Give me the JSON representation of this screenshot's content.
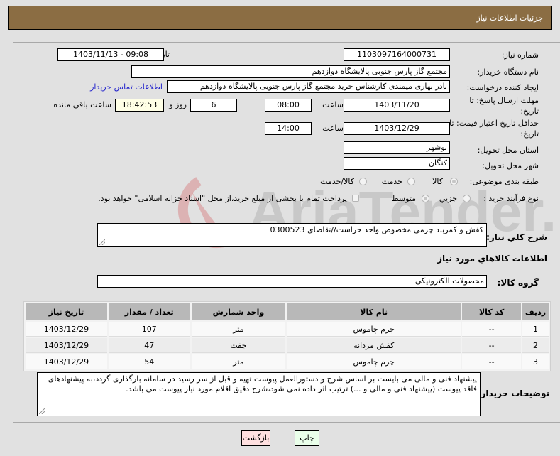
{
  "header": {
    "title": "جزئیات اطلاعات نیاز"
  },
  "watermark": {
    "text": "AriaTender.net",
    "brand_red": "#c0373a",
    "brand_gray": "#888888"
  },
  "form": {
    "need_number": {
      "label": "شماره نیاز:",
      "value": "1103097164000731"
    },
    "announce_datetime": {
      "label": "تاریخ و ساعت اعلان عمومی:",
      "value": "1403/11/13 - 09:08"
    },
    "buyer_org": {
      "label": "نام دستگاه خریدار:",
      "value": "مجتمع گاز پارس جنوبی  پالایشگاه دوازدهم"
    },
    "requester": {
      "label": "ایجاد کننده درخواست:",
      "value": "نادر بهاری میمندی کارشناس خرید مجتمع گاز پارس جنوبی  پالایشگاه دوازدهم"
    },
    "buyer_contact_link": "اطلاعات تماس خریدار",
    "reply_deadline": {
      "label_line1": "مهلت ارسال پاسخ: تا",
      "label_line2": "تاریخ:",
      "date": "1403/11/20",
      "time_label": "ساعت",
      "time": "08:00",
      "days": "6",
      "days_label": "روز و",
      "remaining": "18:42:53",
      "remaining_label": "ساعت باقي مانده"
    },
    "price_validity": {
      "label_line1": "حداقل تاریخ اعتبار قیمت: تا",
      "label_line2": "تاریخ:",
      "date": "1403/12/29",
      "time_label": "ساعت",
      "time": "14:00"
    },
    "delivery_province": {
      "label": "استان محل تحویل:",
      "value": "بوشهر"
    },
    "delivery_city": {
      "label": "شهر محل تحویل:",
      "value": "کنگان"
    },
    "category": {
      "label": "طبقه بندی موضوعی:",
      "options": [
        "کالا",
        "خدمت",
        "کالا/خدمت"
      ],
      "selected": "کالا"
    },
    "purchase_type": {
      "label": "نوع فرآیند خرید :",
      "options": [
        "جزیي",
        "متوسط"
      ],
      "selected": "متوسط",
      "payment_note": "پرداخت تمام یا بخشی از مبلغ خرید،از محل \"اسناد خزانه اسلامی\" خواهد بود.",
      "payment_checked": false
    }
  },
  "description": {
    "label": "شرح کلي نياز:",
    "value": "کفش و کمربند چرمی مخصوص واحد حراست//تقاضای 0300523"
  },
  "goods_section_title": "اطلاعات کالاهاي مورد نياز",
  "goods_group": {
    "label": "گروه کالا:",
    "value": "محصولات الکترونیکی"
  },
  "table": {
    "headers": [
      "ردیف",
      "کد کالا",
      "نام کالا",
      "واحد شمارش",
      "تعداد / مقدار",
      "تاریخ نیاز"
    ],
    "rows": [
      {
        "row": "1",
        "code": "--",
        "name": "چرم چاموس",
        "unit": "متر",
        "qty": "107",
        "date": "1403/12/29"
      },
      {
        "row": "2",
        "code": "--",
        "name": "کفش مردانه",
        "unit": "جفت",
        "qty": "47",
        "date": "1403/12/29"
      },
      {
        "row": "3",
        "code": "--",
        "name": "چرم چاموس",
        "unit": "متر",
        "qty": "54",
        "date": "1403/12/29"
      }
    ]
  },
  "buyer_notes": {
    "label": "توضیحات خریدار:",
    "value": "پیشنهاد فنی و مالی می بایست بر اساس شرح و دستورالعمل پیوست تهیه و قبل از سر رسید در سامانه بارگذاری گردد،به پیشنهادهای فاقد پیوست (پیشنهاد فنی و مالی و ...) ترتیب اثر داده نمی شود،شرح دقیق اقلام مورد نیاز پیوست می باشد."
  },
  "buttons": {
    "print": "چاپ",
    "back": "بازگشت"
  },
  "colors": {
    "header_bg": "#8b6d43",
    "print_bg": "#eaffea",
    "back_bg": "#ffe0e0",
    "link": "#2222cc"
  }
}
